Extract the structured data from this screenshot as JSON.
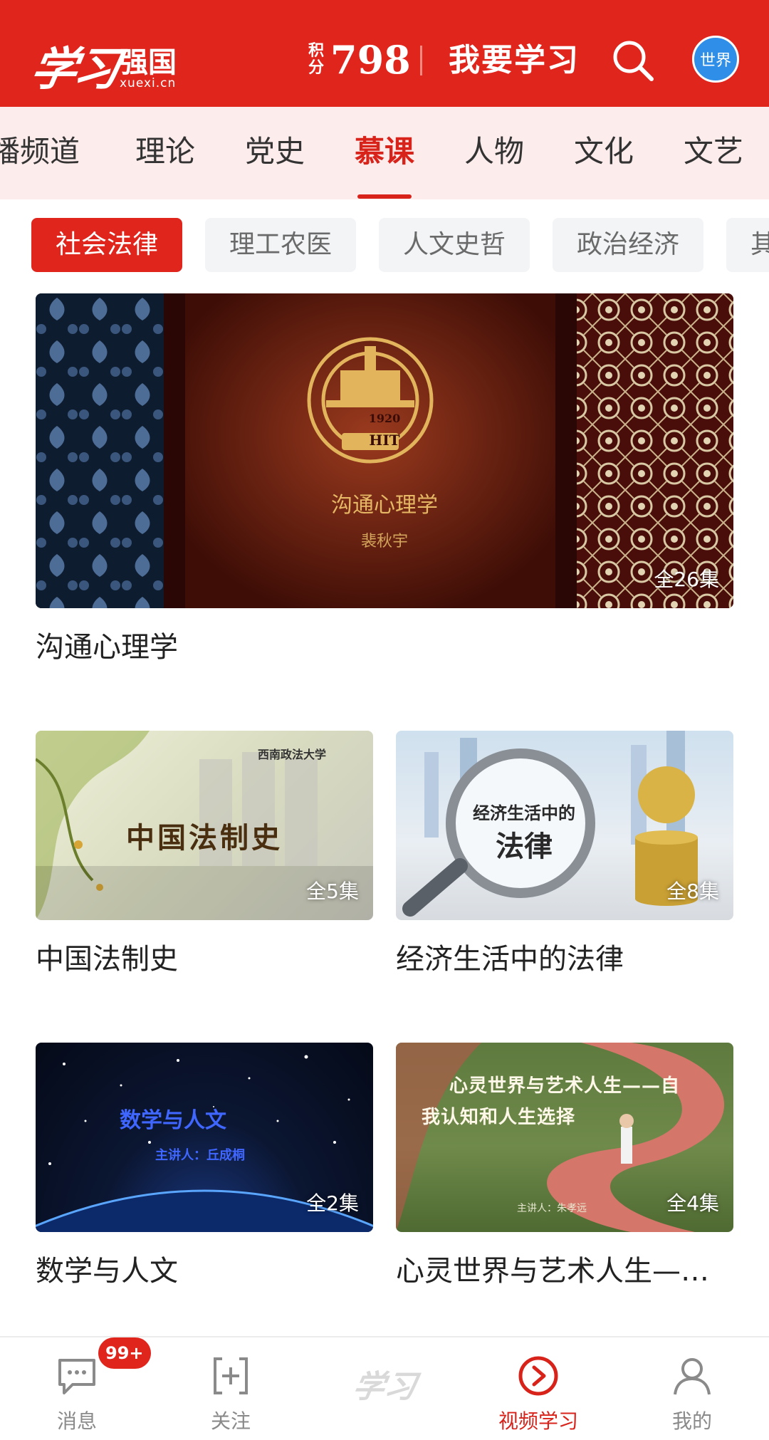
{
  "header": {
    "logo_script": "学习",
    "logo_text": "强国",
    "logo_domain": "xuexi.cn",
    "points_label": "积分",
    "points_value": "798",
    "study_label": "我要学习",
    "world_label": "世界",
    "bg_color": "#e0251d"
  },
  "channels": [
    {
      "label": "播频道"
    },
    {
      "label": "理论"
    },
    {
      "label": "党史"
    },
    {
      "label": "慕课",
      "active": true
    },
    {
      "label": "人物"
    },
    {
      "label": "文化"
    },
    {
      "label": "文艺"
    }
  ],
  "chips": [
    {
      "label": "社会法律",
      "active": true
    },
    {
      "label": "理工农医"
    },
    {
      "label": "人文史哲"
    },
    {
      "label": "政治经济"
    },
    {
      "label": "其"
    }
  ],
  "courses": [
    {
      "title": "沟通心理学",
      "episodes": "全26集",
      "thumb_title": "沟通心理学",
      "thumb_sub": "裴秋宇",
      "thumb_emblem": "HIT",
      "thumb_year": "1920"
    },
    {
      "title": "中国法制史",
      "episodes": "全5集",
      "thumb_title": "中国法制史",
      "thumb_sub": "西南政法大学"
    },
    {
      "title": "经济生活中的法律",
      "episodes": "全8集",
      "thumb_title_line1": "经济生活中的",
      "thumb_title_line2": "法律"
    },
    {
      "title": "数学与人文",
      "episodes": "全2集",
      "thumb_title": "数学与人文",
      "thumb_sub": "主讲人：丘成桐"
    },
    {
      "title": "心灵世界与艺术人生—…",
      "episodes": "全4集",
      "thumb_title_line1": "心灵世界与艺术人生——自",
      "thumb_title_line2": "我认知和人生选择",
      "thumb_sub": "主讲人：朱孝远"
    }
  ],
  "bottom_nav": {
    "messages": {
      "label": "消息",
      "badge": "99+"
    },
    "follow": {
      "label": "关注"
    },
    "center_logo": "学习",
    "video": {
      "label": "视频学习"
    },
    "mine": {
      "label": "我的"
    }
  },
  "colors": {
    "accent": "#e0251d",
    "tab_bg": "#fdecec",
    "chip_bg": "#f2f4f6"
  }
}
